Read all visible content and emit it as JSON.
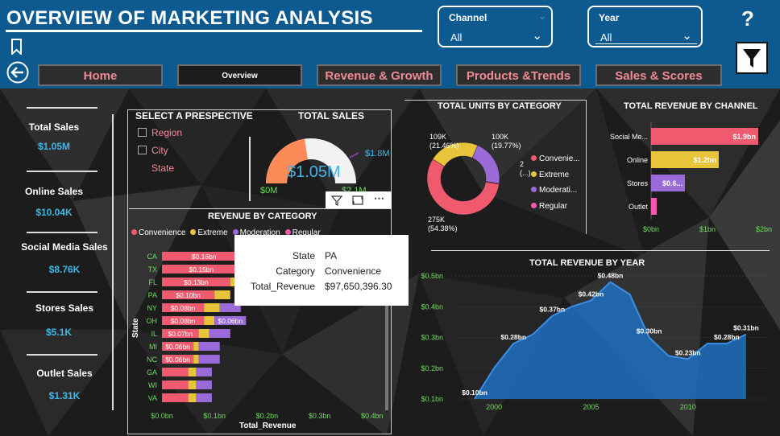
{
  "header": {
    "title": "OVERVIEW OF MARKETING ANALYSIS"
  },
  "slicers": [
    {
      "label": "Channel",
      "value": "All"
    },
    {
      "label": "Year",
      "value": "All"
    }
  ],
  "nav": [
    "Home",
    "Overview",
    "Revenue & Growth",
    "Products &Trends",
    "Sales & Scores"
  ],
  "kpis": [
    {
      "label": "Total Sales",
      "value": "$1.05M"
    },
    {
      "label": "Online Sales",
      "value": "$10.04K"
    },
    {
      "label": "Social Media Sales",
      "value": "$8.76K"
    },
    {
      "label": "Stores Sales",
      "value": "$5.1K"
    },
    {
      "label": "Outlet Sales",
      "value": "$1.31K"
    }
  ],
  "perspective": {
    "title": "SELECT A PRESPECTIVE",
    "options": [
      "Region",
      "City",
      "State"
    ]
  },
  "gauge": {
    "title": "TOTAL SALES",
    "value": "$1.05M",
    "min": "$0M",
    "target": "$1.8M",
    "max": "$2.1M",
    "fraction": 0.5
  },
  "revenue_by_category": {
    "title": "REVENUE BY CATEGORY",
    "ylabel": "State",
    "xlabel": "Total_Revenue"
  },
  "tooltip": [
    {
      "k": "State",
      "v": "PA"
    },
    {
      "k": "Category",
      "v": "Convenience"
    },
    {
      "k": "Total_Revenue",
      "v": "$97,650,396.30"
    }
  ],
  "units_by_category": {
    "title": "TOTAL UNITS BY CATEGORY"
  },
  "revenue_by_channel": {
    "title": "TOTAL REVENUE BY CHANNEL"
  },
  "revenue_by_year": {
    "title": "TOTAL REVENUE BY YEAR"
  },
  "colors": {
    "convenience": "#f05a6e",
    "extreme": "#e8c43a",
    "moderation": "#9a6bd8",
    "regular": "#f25bb0",
    "accent": "#41b6e6",
    "header": "#0d5a91",
    "axis": "#6fdc5c",
    "area": "#1e6fc0"
  },
  "chart_data": [
    {
      "type": "bar",
      "stacked": true,
      "orientation": "horizontal",
      "title": "REVENUE BY CATEGORY",
      "ylabel": "State",
      "xlabel": "Total_Revenue",
      "categories": [
        "CA",
        "TX",
        "FL",
        "PA",
        "NY",
        "OH",
        "IL",
        "MI",
        "NC",
        "GA",
        "WI",
        "VA"
      ],
      "series": [
        {
          "name": "Convenience",
          "values": [
            0.16,
            0.15,
            0.13,
            0.1,
            0.08,
            0.08,
            0.07,
            0.06,
            0.06,
            0.05,
            0.05,
            0.05
          ]
        },
        {
          "name": "Extreme",
          "values": [
            0.03,
            0.03,
            0.03,
            0.03,
            0.03,
            0.02,
            0.02,
            0.01,
            0.01,
            0.015,
            0.015,
            0.015
          ]
        },
        {
          "name": "Moderation",
          "values": [
            0.0,
            0.0,
            0.0,
            0.0,
            0.04,
            0.06,
            0.04,
            0.04,
            0.04,
            0.03,
            0.03,
            0.03
          ]
        },
        {
          "name": "Regular",
          "values": [
            0.0,
            0.0,
            0.0,
            0.0,
            0.0,
            0.0,
            0.0,
            0.0,
            0.0,
            0.0,
            0.0,
            0.0
          ]
        }
      ],
      "data_labels": {
        "CA": "$0.16bn",
        "TX": "$0.15bn",
        "FL": "$0.13bn",
        "PA": "$0.10bn",
        "NY": "$0.08bn",
        "OH": "$0.08bn",
        "OH_moderation": "$0.06bn",
        "IL": "$0.07bn",
        "MI": "$0.06bn",
        "NC": "$0.06bn"
      },
      "xticks": [
        "$0.0bn",
        "$0.1bn",
        "$0.2bn",
        "$0.3bn",
        "$0.4bn"
      ],
      "xlim": [
        0,
        0.4
      ],
      "legend": "top"
    },
    {
      "type": "pie",
      "donut": true,
      "title": "TOTAL UNITS BY CATEGORY",
      "categories": [
        "Convenie...",
        "Extreme",
        "Moderati...",
        "Regular"
      ],
      "values": [
        275,
        109,
        100,
        2
      ],
      "labels": [
        "275K\n(54.38%)",
        "109K\n(21.46%)",
        "100K\n(19.77%)",
        "2\n(...)"
      ],
      "legend": "right"
    },
    {
      "type": "bar",
      "orientation": "horizontal",
      "title": "TOTAL REVENUE BY CHANNEL",
      "categories": [
        "Social Me...",
        "Online",
        "Stores",
        "Outlet"
      ],
      "values": [
        1.9,
        1.2,
        0.6,
        0.1
      ],
      "data_labels": [
        "$1.9bn",
        "$1.2bn",
        "$0.6...",
        ""
      ],
      "colors": [
        "#f05a6e",
        "#e8c43a",
        "#9a6bd8",
        "#f25bb0"
      ],
      "xticks": [
        "$0bn",
        "$1bn",
        "$2bn"
      ],
      "xlim": [
        0,
        2
      ]
    },
    {
      "type": "area",
      "title": "TOTAL REVENUE BY YEAR",
      "x": [
        1999,
        2000,
        2001,
        2002,
        2003,
        2004,
        2005,
        2006,
        2007,
        2008,
        2009,
        2010,
        2011,
        2012,
        2013
      ],
      "y": [
        0.1,
        0.2,
        0.28,
        0.31,
        0.37,
        0.4,
        0.42,
        0.48,
        0.44,
        0.3,
        0.24,
        0.23,
        0.28,
        0.28,
        0.31
      ],
      "point_labels": {
        "1999": "$0.10bn",
        "2001": "$0.28bn",
        "2003": "$0.37bn",
        "2005": "$0.42bn",
        "2006": "$0.48bn",
        "2008": "$0.30bn",
        "2010": "$0.23bn",
        "2012": "$0.28bn",
        "2013": "$0.31bn"
      },
      "yticks": [
        "$0.1bn",
        "$0.2bn",
        "$0.3bn",
        "$0.4bn",
        "$0.5bn"
      ],
      "xticks": [
        "2000",
        "2005",
        "2010"
      ],
      "ylim": [
        0.1,
        0.5
      ],
      "xlim": [
        1998,
        2014
      ]
    }
  ]
}
